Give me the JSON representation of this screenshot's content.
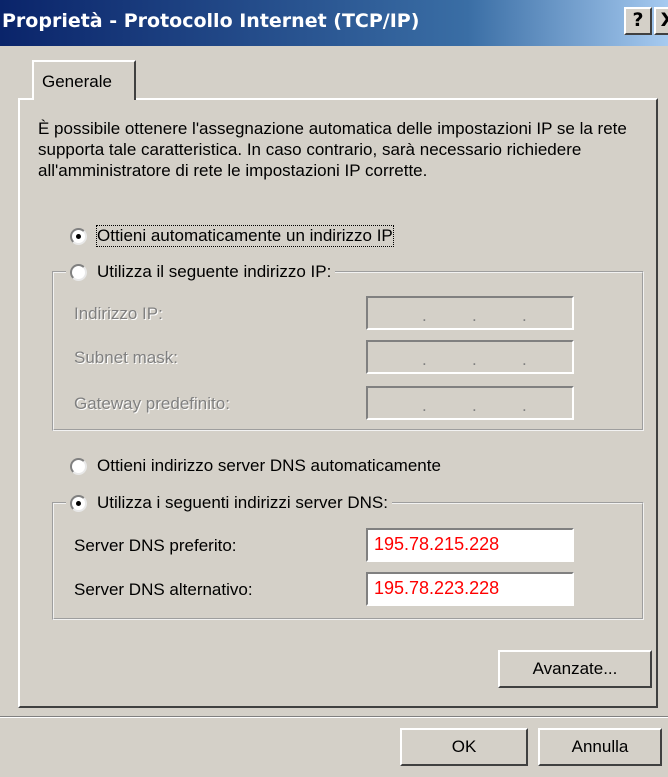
{
  "window": {
    "title": "Proprietà - Protocollo Internet (TCP/IP)",
    "help_label": "?",
    "close_label": "X"
  },
  "tabs": [
    {
      "label": "Generale"
    }
  ],
  "description": "È possibile ottenere l'assegnazione automatica delle impostazioni IP se la rete supporta tale caratteristica. In caso contrario, sarà necessario richiedere all'amministratore di rete le impostazioni IP corrette.",
  "ip": {
    "auto_label": "Ottieni automaticamente un indirizzo IP",
    "auto_checked": true,
    "manual_label": "Utilizza il seguente indirizzo IP:",
    "manual_checked": false,
    "fields": [
      {
        "label": "Indirizzo IP:",
        "value": "",
        "placeholder": ".   .   ."
      },
      {
        "label": "Subnet mask:",
        "value": "",
        "placeholder": ".   .   ."
      },
      {
        "label": "Gateway predefinito:",
        "value": "",
        "placeholder": ".   .   ."
      }
    ]
  },
  "dns": {
    "auto_label": "Ottieni indirizzo server DNS automaticamente",
    "auto_checked": false,
    "manual_label": "Utilizza i seguenti indirizzi server DNS:",
    "manual_checked": true,
    "preferred_label": "Server DNS preferito:",
    "preferred_value": "195.78.215.228",
    "alternate_label": "Server DNS alternativo:",
    "alternate_value": "195.78.223.228"
  },
  "buttons": {
    "advanced": "Avanzate...",
    "ok": "OK",
    "cancel": "Annulla"
  },
  "colors": {
    "dns_value_text": "#ff0000",
    "title_bar": "#0a246a",
    "dialog_bg": "#d4d0c8"
  }
}
